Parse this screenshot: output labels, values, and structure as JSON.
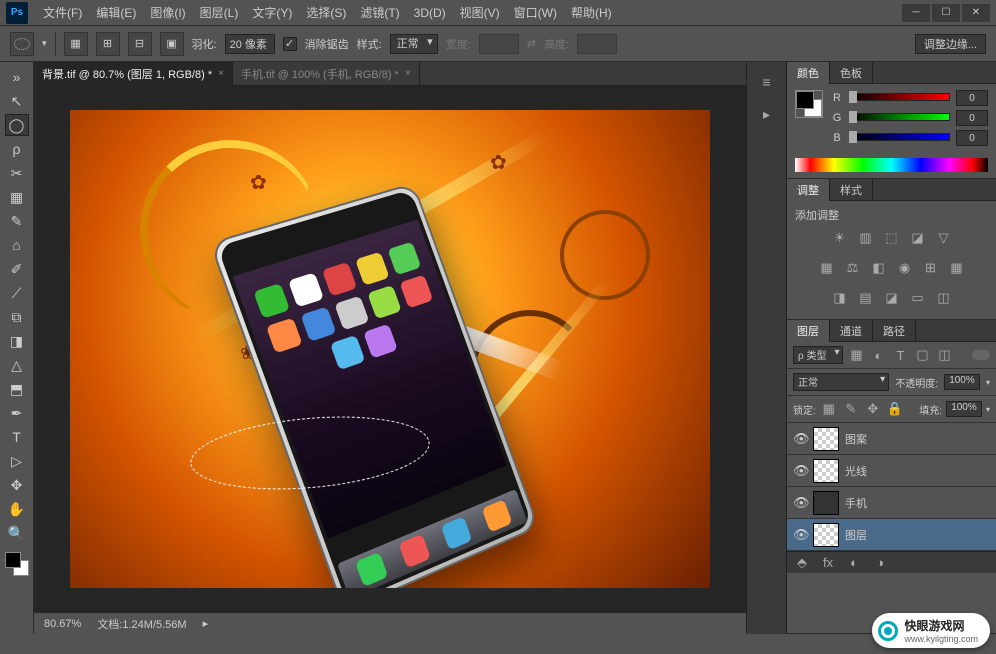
{
  "app": {
    "logo": "Ps"
  },
  "menu": [
    "文件(F)",
    "编辑(E)",
    "图像(I)",
    "图层(L)",
    "文字(Y)",
    "选择(S)",
    "滤镜(T)",
    "3D(D)",
    "视图(V)",
    "窗口(W)",
    "帮助(H)"
  ],
  "options": {
    "feather_label": "羽化:",
    "feather_value": "20 像素",
    "antialias": "消除锯齿",
    "style_label": "样式:",
    "style_value": "正常",
    "width_label": "宽度:",
    "height_label": "高度:",
    "refine_edge": "调整边缘..."
  },
  "tabs": [
    {
      "title": "背景.tif @ 80.7% (图层 1, RGB/8) *",
      "active": true
    },
    {
      "title": "手机.tif @ 100% (手机, RGB/8) *",
      "active": false
    }
  ],
  "tools": [
    "↖",
    "◯",
    "ρ",
    "✂",
    "▦",
    "✎",
    "⌂",
    "✐",
    "⟋",
    "⧉",
    "◨",
    "△",
    "⬒",
    "✒",
    "T",
    "▷",
    "✥",
    "⬚",
    "✋",
    "🔍"
  ],
  "status": {
    "zoom": "80.67%",
    "doc": "文档:1.24M/5.56M"
  },
  "panels": {
    "color": {
      "tabs": [
        "颜色",
        "色板"
      ],
      "channels": [
        {
          "label": "R",
          "value": "0"
        },
        {
          "label": "G",
          "value": "0"
        },
        {
          "label": "B",
          "value": "0"
        }
      ]
    },
    "adjust": {
      "tabs": [
        "调整",
        "样式"
      ],
      "add_label": "添加调整"
    },
    "layers": {
      "tabs": [
        "图层",
        "通道",
        "路径"
      ],
      "filter_label": "ρ 类型",
      "blend_mode": "正常",
      "opacity_label": "不透明度:",
      "opacity_value": "100%",
      "lock_label": "锁定:",
      "fill_label": "填充:",
      "fill_value": "100%",
      "items": [
        {
          "name": "图案"
        },
        {
          "name": "光线"
        },
        {
          "name": "手机"
        },
        {
          "name": "图层"
        }
      ]
    }
  },
  "watermark": {
    "text": "快眼游戏网",
    "url": "www.kyilgting.com"
  }
}
